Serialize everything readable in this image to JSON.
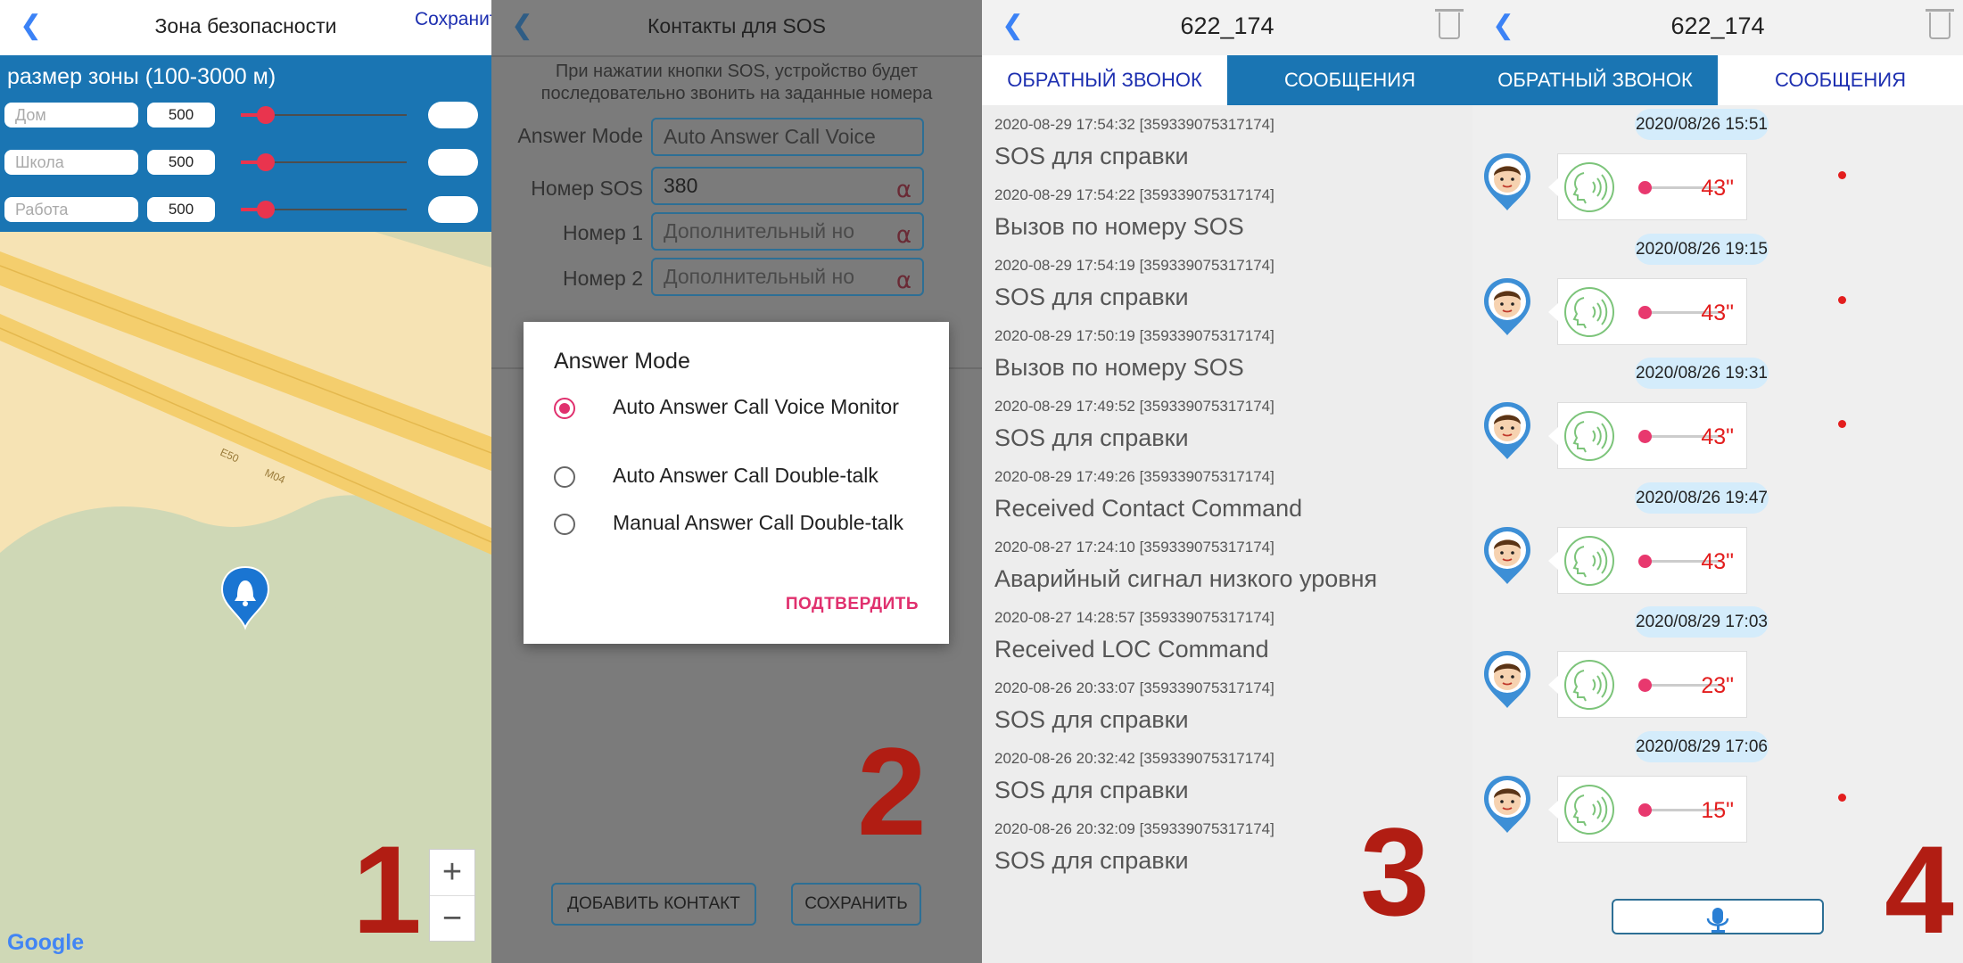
{
  "panel1": {
    "title": "Зона безопасности",
    "save_label": "Сохранить",
    "zone_heading": "размер зоны (100-3000 м)",
    "zones": [
      {
        "name": "Дом",
        "value": "500"
      },
      {
        "name": "Школа",
        "value": "500"
      },
      {
        "name": "Работа",
        "value": "500"
      }
    ],
    "road_labels": [
      "E50",
      "M04"
    ],
    "zoom_in": "+",
    "zoom_out": "−",
    "map_logo": "Google",
    "step_number": "1"
  },
  "panel2": {
    "title": "Контакты для SOS",
    "description": "При нажатии кнопки SOS, устройство будет последовательно звонить на заданные номера",
    "answer_mode_label": "Answer Mode",
    "answer_mode_value": "Auto Answer Call Voice",
    "sos_label": "Номер SOS",
    "sos_value": "380",
    "number1_label": "Номер 1",
    "number1_placeholder": "Дополнительный но",
    "number2_label": "Номер 2",
    "number2_placeholder": "Дополнительный но",
    "dialog": {
      "title": "Answer Mode",
      "options": [
        {
          "label": "Auto Answer Call Voice Monitor",
          "selected": true
        },
        {
          "label": "Auto Answer Call Double-talk",
          "selected": false
        },
        {
          "label": "Manual Answer Call Double-talk",
          "selected": false
        }
      ],
      "confirm": "ПОДТВЕРДИТЬ"
    },
    "add_contact": "ДОБАВИТЬ КОНТАКТ",
    "save": "СОХРАНИТЬ",
    "step_number": "2"
  },
  "panel3": {
    "title": "622_174",
    "tab_callback": "ОБРАТНЫЙ ЗВОНОК",
    "tab_messages": "СООБЩЕНИЯ",
    "messages": [
      {
        "meta": "2020-08-29 17:54:32  [359339075317174]",
        "text": "SOS для справки"
      },
      {
        "meta": "2020-08-29 17:54:22  [359339075317174]",
        "text": "Вызов по номеру SOS"
      },
      {
        "meta": "2020-08-29 17:54:19  [359339075317174]",
        "text": "SOS для справки"
      },
      {
        "meta": "2020-08-29 17:50:19  [359339075317174]",
        "text": "Вызов по номеру SOS"
      },
      {
        "meta": "2020-08-29 17:49:52  [359339075317174]",
        "text": "SOS для справки"
      },
      {
        "meta": "2020-08-29 17:49:26  [359339075317174]",
        "text": "Received Contact Command"
      },
      {
        "meta": "2020-08-27 17:24:10  [359339075317174]",
        "text": "Аварийный сигнал низкого уровня"
      },
      {
        "meta": "2020-08-27 14:28:57  [359339075317174]",
        "text": "Received LOC Command"
      },
      {
        "meta": "2020-08-26 20:33:07  [359339075317174]",
        "text": "SOS для справки"
      },
      {
        "meta": "2020-08-26 20:32:42  [359339075317174]",
        "text": "SOS для справки"
      },
      {
        "meta": "2020-08-26 20:32:09  [359339075317174]",
        "text": "SOS для справки"
      }
    ],
    "step_number": "3"
  },
  "panel4": {
    "title": "622_174",
    "tab_callback": "ОБРАТНЫЙ ЗВОНОК",
    "tab_messages": "СООБЩЕНИЯ",
    "voice_messages": [
      {
        "date": "2020/08/26 15:51",
        "duration": "43\"",
        "unread": true
      },
      {
        "date": "2020/08/26 19:15",
        "duration": "43\"",
        "unread": true
      },
      {
        "date": "2020/08/26 19:31",
        "duration": "43\"",
        "unread": true
      },
      {
        "date": "2020/08/26 19:47",
        "duration": "43\"",
        "unread": false
      },
      {
        "date": "2020/08/29 17:03",
        "duration": "23\"",
        "unread": false
      },
      {
        "date": "2020/08/29 17:06",
        "duration": "15\"",
        "unread": true
      }
    ],
    "step_number": "4"
  },
  "colors": {
    "accent_blue": "#1a75b3",
    "link_blue": "#1d2fb0",
    "slider_red": "#e9344e",
    "dialog_pink": "#e0306e",
    "step_number_red": "#b11d13",
    "date_pill": "#d4ecfb"
  }
}
